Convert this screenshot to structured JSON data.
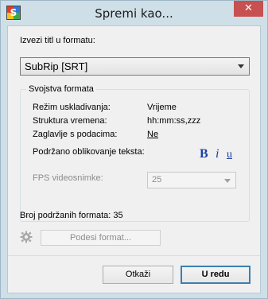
{
  "window": {
    "title": "Spremi kao...",
    "close_glyph": "✕"
  },
  "format": {
    "label": "Izvezi titl u formatu:",
    "selected": "SubRip [SRT]"
  },
  "properties": {
    "legend": "Svojstva formata",
    "sync_mode_label": "Režim uskladivanja:",
    "sync_mode_value": "Vrijeme",
    "time_structure_label": "Struktura vremena:",
    "time_structure_value": "hh:mm:ss,zzz",
    "header_label": "Zaglavlje s podacima:",
    "header_value": "Ne",
    "formatting_label": "Podržano oblikovanje teksta:",
    "bold_glyph": "B",
    "italic_glyph": "i",
    "underline_glyph": "u",
    "fps_label": "FPS videosnimke:",
    "fps_value": "25"
  },
  "supported_count_label": "Broj podržanih formata: 35",
  "settings_button": "Podesi format...",
  "buttons": {
    "cancel": "Otkaži",
    "ok": "U redu"
  },
  "icons": {
    "app": "app-icon",
    "gear": "gear-icon",
    "close": "close-icon"
  }
}
